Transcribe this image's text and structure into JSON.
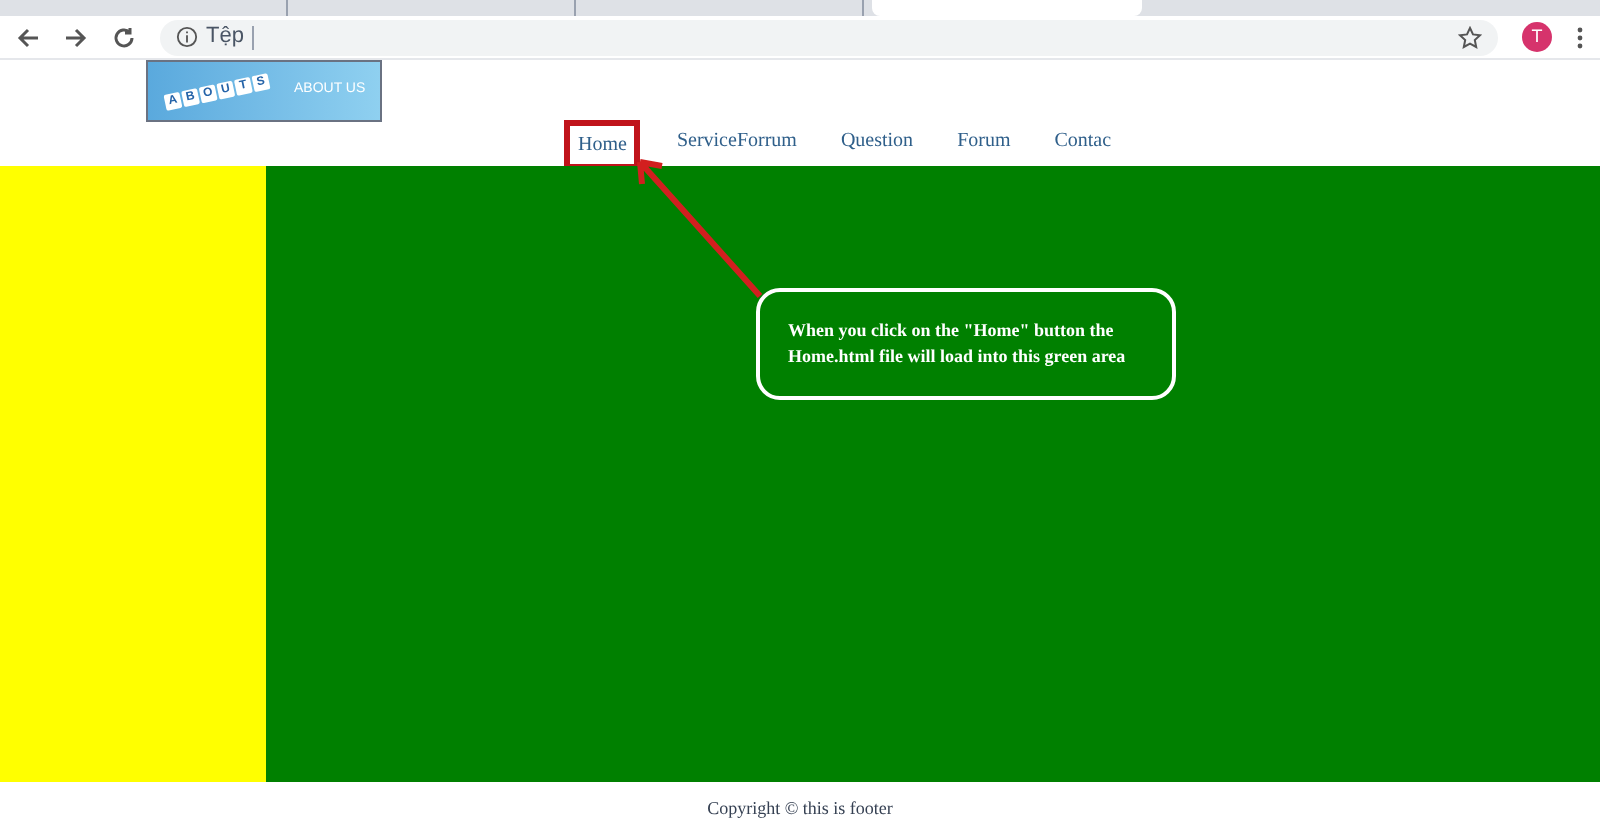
{
  "browser": {
    "tabs": [
      {
        "selected": false
      },
      {
        "selected": false
      },
      {
        "selected": false
      },
      {
        "selected": true
      }
    ],
    "address_prefix": "Tệp",
    "avatar": "T"
  },
  "logo": {
    "tiles": [
      "A",
      "B",
      "O",
      "U",
      "T",
      "S"
    ],
    "text": "ABOUT US"
  },
  "nav": [
    {
      "label": "Home",
      "selected": true
    },
    {
      "label": "ServiceForrum",
      "selected": false
    },
    {
      "label": "Question",
      "selected": false
    },
    {
      "label": "Forum",
      "selected": false
    },
    {
      "label": "Contac",
      "selected": false
    }
  ],
  "callout": {
    "text": "When you click on the \"Home\" button the Home.html file will load into this green area"
  },
  "footer": {
    "text": "Copyright © this is footer"
  }
}
